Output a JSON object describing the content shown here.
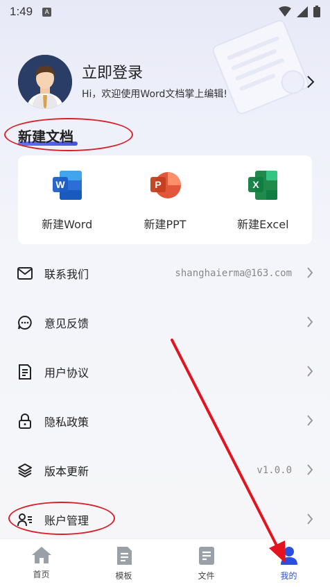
{
  "status_bar": {
    "time": "1:49",
    "notif_letter": "A"
  },
  "profile": {
    "title": "立即登录",
    "subtitle": "Hi，欢迎使用Word文档掌上编辑!"
  },
  "new_doc": {
    "title": "新建文档",
    "items": [
      {
        "label": "新建Word",
        "letter": "W",
        "color": "#2b6fd6"
      },
      {
        "label": "新建PPT",
        "letter": "P",
        "color": "#e2563b"
      },
      {
        "label": "新建Excel",
        "letter": "X",
        "color": "#1f8a4c"
      }
    ]
  },
  "menu": {
    "contact": {
      "label": "联系我们",
      "value": "shanghaierma@163.com"
    },
    "feedback": {
      "label": "意见反馈"
    },
    "agreement": {
      "label": "用户协议"
    },
    "privacy": {
      "label": "隐私政策"
    },
    "version": {
      "label": "版本更新",
      "value": "v1.0.0"
    },
    "account": {
      "label": "账户管理"
    }
  },
  "tabbar": {
    "tabs": [
      {
        "label": "首页",
        "icon": "home-icon",
        "active": false
      },
      {
        "label": "模板",
        "icon": "template-icon",
        "active": false
      },
      {
        "label": "文件",
        "icon": "file-icon",
        "active": false
      },
      {
        "label": "我的",
        "icon": "person-icon",
        "active": true
      }
    ]
  },
  "colors": {
    "accent": "#2a4fe0",
    "annotation": "#d8202a"
  }
}
